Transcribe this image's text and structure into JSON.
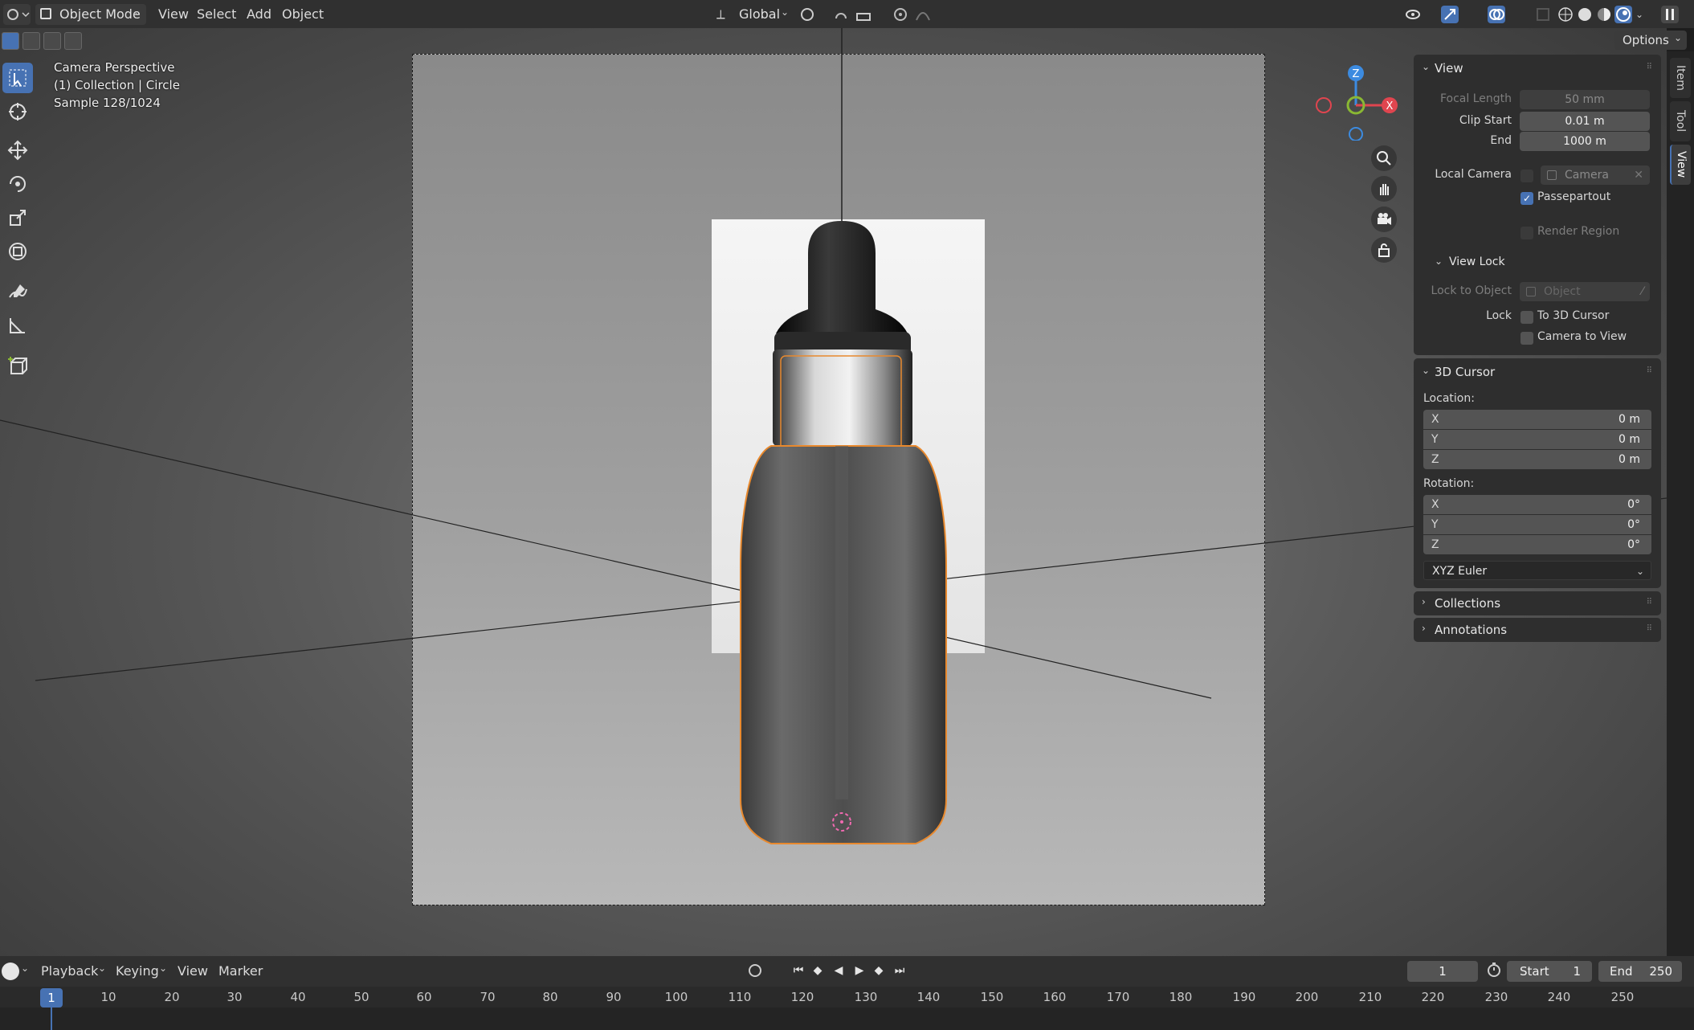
{
  "header": {
    "mode": "Object Mode",
    "menus": [
      "View",
      "Select",
      "Add",
      "Object"
    ],
    "transform_orientation": "Global",
    "options_label": "Options"
  },
  "overlay": {
    "line1": "Camera Perspective",
    "line2": "(1) Collection | Circle",
    "line3": "Sample 128/1024"
  },
  "gizmo": {
    "z": "Z",
    "x": "X"
  },
  "npanel": {
    "view": {
      "title": "View",
      "focal_length_label": "Focal Length",
      "focal_length": "50 mm",
      "clip_start_label": "Clip Start",
      "clip_start": "0.01 m",
      "end_label": "End",
      "end": "1000 m",
      "local_camera_label": "Local Camera",
      "local_camera_value": "Camera",
      "passepartout": "Passepartout",
      "render_region": "Render Region",
      "view_lock": {
        "title": "View Lock",
        "lock_to_object_label": "Lock to Object",
        "lock_to_object_value": "Object",
        "lock_label": "Lock",
        "to_3d_cursor": "To 3D Cursor",
        "camera_to_view": "Camera to View"
      }
    },
    "cursor": {
      "title": "3D Cursor",
      "location_label": "Location:",
      "location": [
        {
          "axis": "X",
          "value": "0 m"
        },
        {
          "axis": "Y",
          "value": "0 m"
        },
        {
          "axis": "Z",
          "value": "0 m"
        }
      ],
      "rotation_label": "Rotation:",
      "rotation": [
        {
          "axis": "X",
          "value": "0°"
        },
        {
          "axis": "Y",
          "value": "0°"
        },
        {
          "axis": "Z",
          "value": "0°"
        }
      ],
      "rotation_mode": "XYZ Euler"
    },
    "collections": "Collections",
    "annotations": "Annotations",
    "tabs": [
      "Item",
      "Tool",
      "View"
    ]
  },
  "timeline": {
    "menus": [
      "Playback",
      "Keying",
      "View",
      "Marker"
    ],
    "current_frame": "1",
    "start_label": "Start",
    "start": "1",
    "end_label": "End",
    "end": "250",
    "ruler": [
      "1",
      "10",
      "20",
      "30",
      "40",
      "50",
      "60",
      "70",
      "80",
      "90",
      "100",
      "110",
      "120",
      "130",
      "140",
      "150",
      "160",
      "170",
      "180",
      "190",
      "200",
      "210",
      "220",
      "230",
      "240",
      "250"
    ]
  },
  "colors": {
    "accent": "#4772b3",
    "selection_outline": "#e8892e",
    "axis_x": "#e0454f",
    "axis_y": "#8ab833",
    "axis_z": "#3c8be0"
  }
}
